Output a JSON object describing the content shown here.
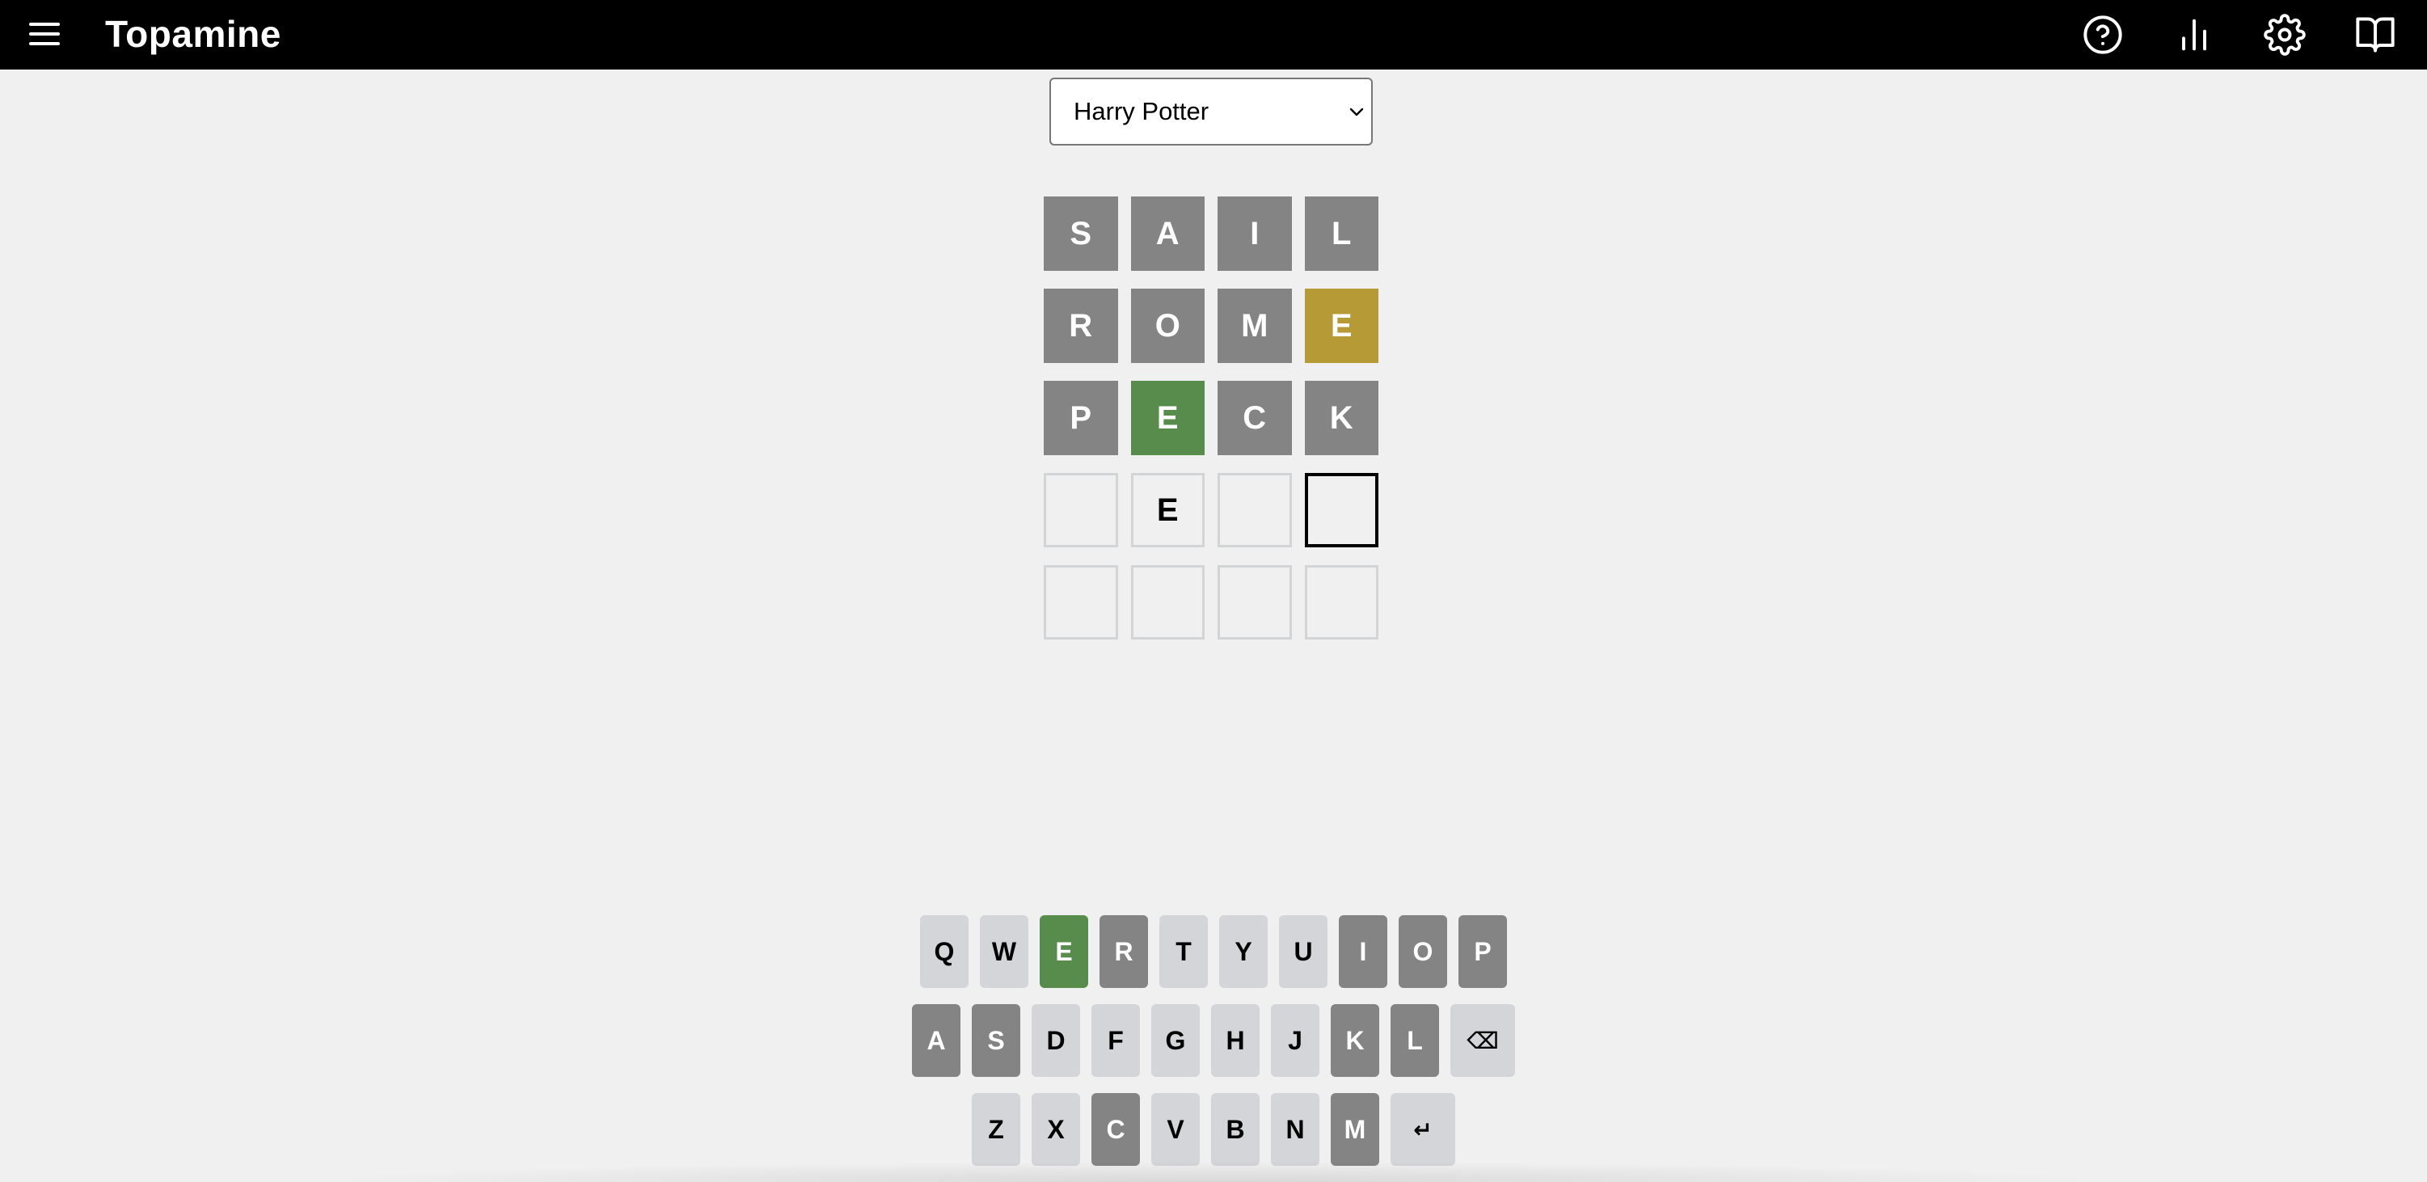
{
  "header": {
    "title": "Topamine",
    "icons": [
      "menu-icon",
      "help-icon",
      "stats-icon",
      "gear-icon",
      "book-icon"
    ]
  },
  "category_select": {
    "selected": "Harry Potter"
  },
  "colors": {
    "header_bg": "#000000",
    "page_bg": "#f0f0f0",
    "absent": "#848484",
    "present": "#b59a36",
    "correct": "#588c4c",
    "key_default": "#d4d5d8",
    "empty_border": "#d3d4d6"
  },
  "board": {
    "rows": [
      [
        {
          "letter": "S",
          "state": "absent"
        },
        {
          "letter": "A",
          "state": "absent"
        },
        {
          "letter": "I",
          "state": "absent"
        },
        {
          "letter": "L",
          "state": "absent"
        }
      ],
      [
        {
          "letter": "R",
          "state": "absent"
        },
        {
          "letter": "O",
          "state": "absent"
        },
        {
          "letter": "M",
          "state": "absent"
        },
        {
          "letter": "E",
          "state": "present"
        }
      ],
      [
        {
          "letter": "P",
          "state": "absent"
        },
        {
          "letter": "E",
          "state": "correct"
        },
        {
          "letter": "C",
          "state": "absent"
        },
        {
          "letter": "K",
          "state": "absent"
        }
      ],
      [
        {
          "letter": "",
          "state": "empty"
        },
        {
          "letter": "E",
          "state": "filled"
        },
        {
          "letter": "",
          "state": "empty"
        },
        {
          "letter": "",
          "state": "active"
        }
      ],
      [
        {
          "letter": "",
          "state": "empty"
        },
        {
          "letter": "",
          "state": "empty"
        },
        {
          "letter": "",
          "state": "empty"
        },
        {
          "letter": "",
          "state": "empty"
        }
      ]
    ]
  },
  "keyboard": {
    "rows": [
      [
        {
          "label": "Q",
          "state": "default"
        },
        {
          "label": "W",
          "state": "default"
        },
        {
          "label": "E",
          "state": "correct"
        },
        {
          "label": "R",
          "state": "absent"
        },
        {
          "label": "T",
          "state": "default"
        },
        {
          "label": "Y",
          "state": "default"
        },
        {
          "label": "U",
          "state": "default"
        },
        {
          "label": "I",
          "state": "absent"
        },
        {
          "label": "O",
          "state": "absent"
        },
        {
          "label": "P",
          "state": "absent"
        }
      ],
      [
        {
          "label": "A",
          "state": "absent"
        },
        {
          "label": "S",
          "state": "absent"
        },
        {
          "label": "D",
          "state": "default"
        },
        {
          "label": "F",
          "state": "default"
        },
        {
          "label": "G",
          "state": "default"
        },
        {
          "label": "H",
          "state": "default"
        },
        {
          "label": "J",
          "state": "default"
        },
        {
          "label": "K",
          "state": "absent"
        },
        {
          "label": "L",
          "state": "absent"
        },
        {
          "label": "⌫",
          "state": "default",
          "name": "backspace",
          "wide": true
        }
      ],
      [
        {
          "label": "Z",
          "state": "default"
        },
        {
          "label": "X",
          "state": "default"
        },
        {
          "label": "C",
          "state": "absent"
        },
        {
          "label": "V",
          "state": "default"
        },
        {
          "label": "B",
          "state": "default"
        },
        {
          "label": "N",
          "state": "default"
        },
        {
          "label": "M",
          "state": "absent"
        },
        {
          "label": "↵",
          "state": "default",
          "name": "enter",
          "wide": true
        }
      ]
    ]
  }
}
